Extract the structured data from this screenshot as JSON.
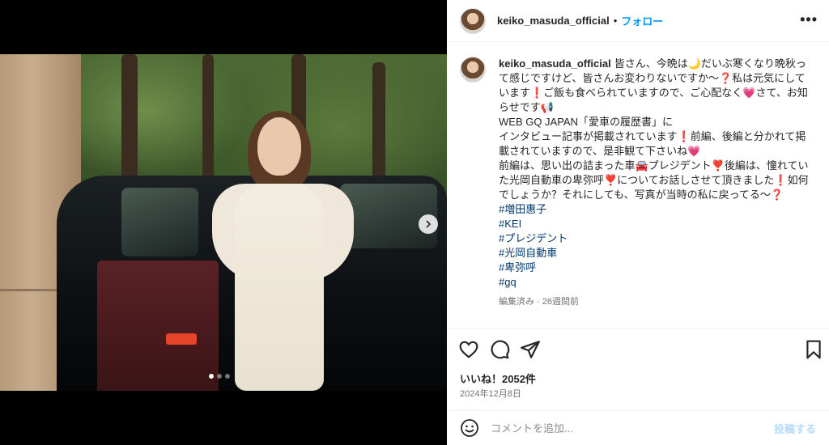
{
  "post": {
    "username": "keiko_masuda_official",
    "separator": "•",
    "follow_label": "フォロー",
    "more_label": "•••",
    "caption_lines": [
      "皆さん、今晩は🌙だいぶ寒くなり晩秋って感じですけど、皆さんお変わりないですか〜❓私は元気にしています❗ご飯も食べられていますので、ご心配なく💗さて、お知らせです📢",
      "WEB GQ JAPAN「愛車の履歴書」に",
      "インタビュー記事が掲載されています❗前編、後編と分かれて掲載されていますので、是非観て下さいね💗",
      "前編は、思い出の詰まった車🚘プレジデント❣️後編は、憧れていた光岡自動車の卑弥呼❣️についてお話しさせて頂きました❗如何でしょうか？それにしても、写真が当時の私に戻ってる〜❓"
    ],
    "hashtags": [
      "#増田惠子",
      "#KEI",
      "#プレジデント",
      "#光岡自動車",
      "#卑弥呼",
      "#gq"
    ],
    "caption_meta": "編集済み · 26週間前",
    "likes": "いいね！2052件",
    "date": "2024年12月8日",
    "comment_placeholder": "コメントを追加...",
    "post_button": "投稿する",
    "carousel": {
      "slide_count": 3,
      "active_index": 0
    }
  },
  "icons": {
    "like": "heart-icon",
    "comment": "comment-icon",
    "share": "share-icon",
    "save": "bookmark-icon",
    "emoji": "emoji-icon",
    "next": "chevron-right-icon"
  },
  "colors": {
    "accent": "#0095f6",
    "hashtag": "#00376b",
    "muted": "#737373"
  }
}
